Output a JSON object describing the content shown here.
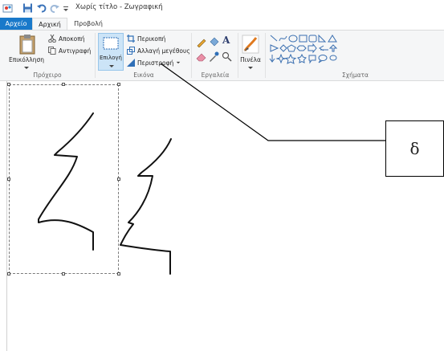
{
  "window": {
    "title": "Χωρίς τίτλο - Ζωγραφική"
  },
  "tabs": {
    "file": "Αρχείο",
    "home": "Αρχική",
    "view": "Προβολή"
  },
  "ribbon": {
    "clipboard": {
      "paste": "Επικόλληση",
      "cut": "Αποκοπή",
      "copy": "Αντιγραφή",
      "group": "Πρόχειρο"
    },
    "image": {
      "select": "Επιλογή",
      "crop": "Περικοπή",
      "resize": "Αλλαγή μεγέθους",
      "rotate": "Περιστροφή",
      "group": "Εικόνα"
    },
    "tools": {
      "group": "Εργαλεία"
    },
    "brushes": {
      "label": "Πινέλα"
    },
    "shapes": {
      "group": "Σχήματα"
    }
  },
  "annotation": {
    "label": "δ"
  },
  "colors": {
    "accent": "#1979ca",
    "ribbon_bg": "#f5f6f7",
    "select_bg": "#cce4f7"
  }
}
